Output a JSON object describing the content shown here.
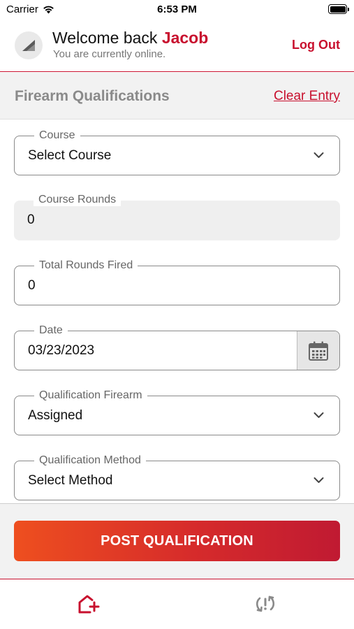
{
  "status_bar": {
    "carrier": "Carrier",
    "time": "6:53 PM"
  },
  "header": {
    "welcome_prefix": "Welcome back ",
    "user_name": "Jacob",
    "status": "You are currently online.",
    "logout_label": "Log Out"
  },
  "section": {
    "title": "Firearm Qualifications",
    "clear_label": "Clear Entry"
  },
  "form": {
    "course": {
      "label": "Course",
      "value": "Select Course"
    },
    "course_rounds": {
      "label": "Course Rounds",
      "value": "0"
    },
    "total_rounds": {
      "label": "Total Rounds Fired",
      "value": "0"
    },
    "date": {
      "label": "Date",
      "value": "03/23/2023"
    },
    "firearm": {
      "label": "Qualification Firearm",
      "value": "Assigned"
    },
    "method": {
      "label": "Qualification Method",
      "value": "Select Method"
    }
  },
  "actions": {
    "post_label": "POST QUALIFICATION"
  },
  "tabs": {
    "home_icon": "home-add-icon",
    "sync_icon": "sync-alert-icon"
  },
  "colors": {
    "accent": "#c8102e",
    "gradient_start": "#ee4f1f",
    "gradient_end": "#c01a32"
  }
}
